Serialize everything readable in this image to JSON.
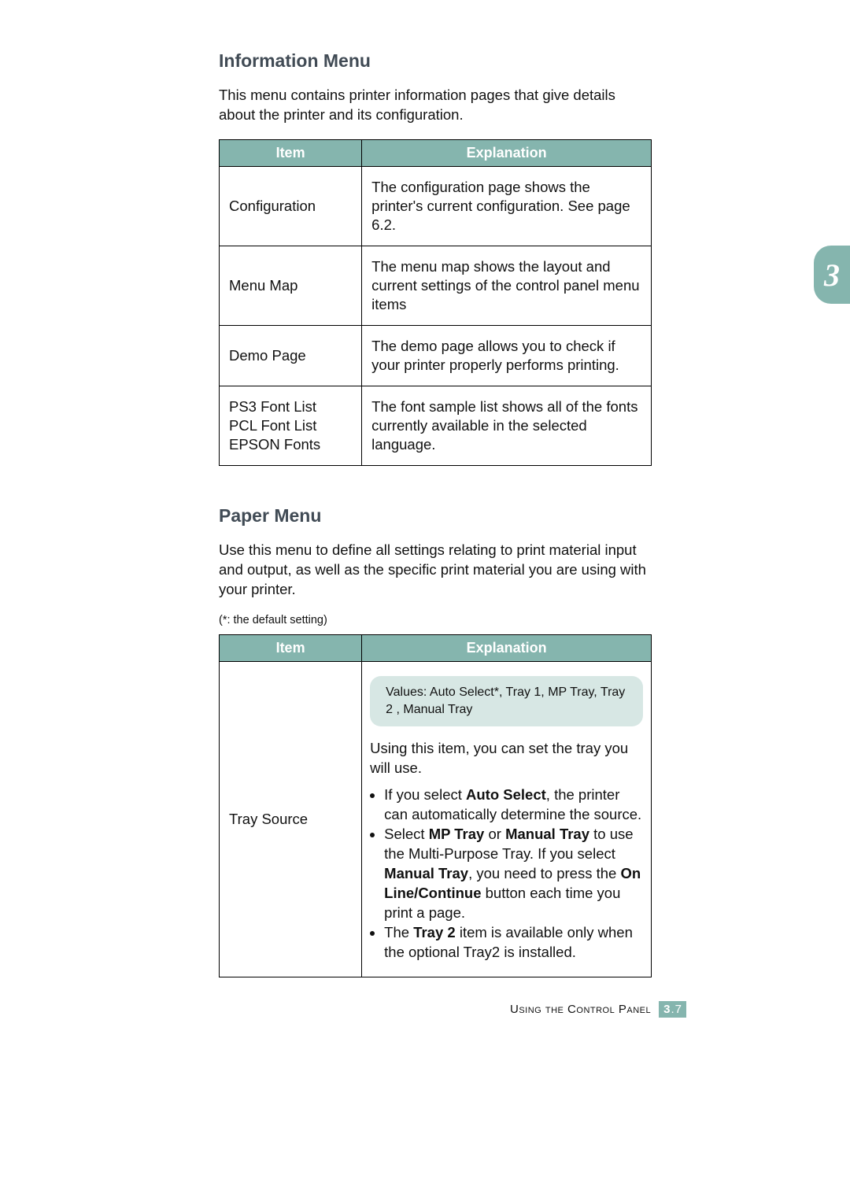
{
  "chapter_tab": "3",
  "section1": {
    "heading": "Information Menu",
    "intro": "This menu contains printer information pages that give details about the printer and its configuration.",
    "headers": {
      "item": "Item",
      "explanation": "Explanation"
    },
    "rows": [
      {
        "item": "Configuration",
        "explanation": "The configuration page shows the printer's current configuration. See page 6.2."
      },
      {
        "item": "Menu Map",
        "explanation": "The menu map shows the layout and current settings of the control panel menu items"
      },
      {
        "item": "Demo Page",
        "explanation": "The demo page allows you to check if your printer properly performs printing."
      },
      {
        "item": "PS3 Font List\nPCL Font List\nEPSON Fonts",
        "explanation": "The font sample list shows all of the fonts currently available in the selected language."
      }
    ]
  },
  "section2": {
    "heading": "Paper Menu",
    "intro": "Use this menu to define all settings relating to print material input and output, as well as the specific print material you are using with your printer.",
    "note": "(*: the default setting)",
    "headers": {
      "item": "Item",
      "explanation": "Explanation"
    },
    "row": {
      "item": "Tray Source",
      "values_text": "Values: Auto Select*, Tray 1, MP Tray, Tray 2 , Manual Tray",
      "lead": "Using this item, you can set the tray you will use.",
      "b1a": "If you select ",
      "b1b": "Auto Select",
      "b1c": ", the printer can automatically determine the source.",
      "b2a": "Select ",
      "b2b": "MP Tray",
      "b2c": " or ",
      "b2d": "Manual Tray",
      "b2e": " to use the Multi-Purpose Tray. If you select ",
      "b2f": "Manual Tray",
      "b2g": ", you need to press the ",
      "b2h": "On Line/Continue",
      "b2i": " button each time you print a page.",
      "b3a": "The ",
      "b3b": "Tray 2",
      "b3c": " item is available only when the optional Tray2 is installed."
    }
  },
  "footer": {
    "label": "Using the Control Panel",
    "section": "3",
    "page": "7"
  }
}
